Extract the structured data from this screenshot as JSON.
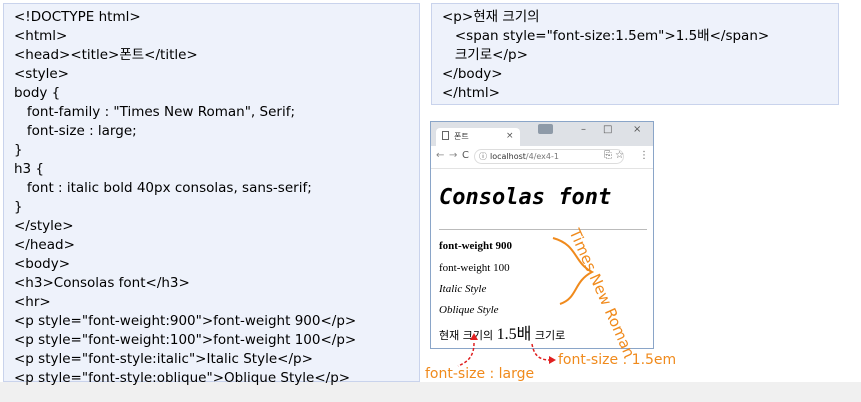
{
  "code_left": {
    "lines": [
      "<!DOCTYPE html>",
      "<html>",
      "<head><title>폰트</title>",
      "<style>",
      "body {",
      "   font-family : \"Times New Roman\", Serif;",
      "   font-size : large;",
      "}",
      "h3 {",
      "   font : italic bold 40px consolas, sans-serif;",
      "}",
      "</style>",
      "</head>",
      "<body>",
      "<h3>Consolas font</h3>",
      "<hr>",
      "<p style=\"font-weight:900\">font-weight 900</p>",
      "<p style=\"font-weight:100\">font-weight 100</p>",
      "<p style=\"font-style:italic\">Italic Style</p>",
      "<p style=\"font-style:oblique\">Oblique Style</p>"
    ]
  },
  "code_right": {
    "lines": [
      "<p>현재 크기의",
      "   <span style=\"font-size:1.5em\">1.5배</span>",
      "   크기로</p>",
      "</body>",
      "</html>"
    ]
  },
  "browser": {
    "tab_title": "폰트",
    "tab_close": "×",
    "win_min": "–",
    "win_max": "□",
    "win_close": "×",
    "back": "←",
    "forward": "→",
    "reload": "C",
    "url_host": "localhost",
    "url_path": "/4/ex4-1",
    "menu": "⋮",
    "page": {
      "h3": "Consolas font",
      "p1": "font-weight 900",
      "p2": "font-weight 100",
      "p3": "Italic Style",
      "p4": "Oblique Style",
      "p5_pre": "현재 크기의 ",
      "p5_span": "1.5배",
      "p5_post": " 크기로"
    }
  },
  "annotations": {
    "tnr": "Times New Roman",
    "font_size_large": "font-size : large",
    "font_size_15em": "font-size : 1.5em",
    "color": "#f08a1c"
  }
}
